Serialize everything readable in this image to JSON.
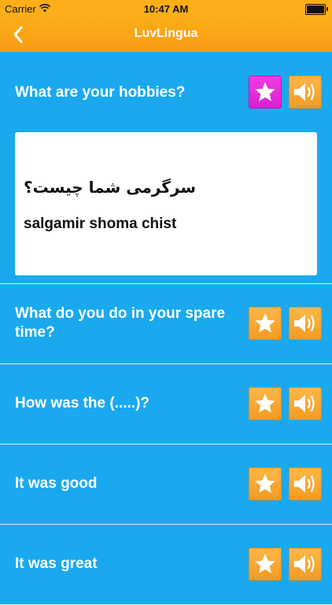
{
  "status_bar": {
    "carrier": "Carrier",
    "time": "10:47 AM",
    "wifi_icon": "wifi-icon",
    "battery_icon": "battery-icon"
  },
  "nav": {
    "title": "LuvLingua",
    "back_icon": "chevron-left-icon"
  },
  "colors": {
    "header_orange": "#fbae18",
    "list_background": "#1aa9ee",
    "favorite_active": "#e82bdc",
    "favorite_inactive": "#f7a52f"
  },
  "phrases": [
    {
      "text": "What are your hobbies?",
      "favorited": true,
      "expanded": true,
      "translation": "سرگرمی شما چیست؟",
      "transliteration": "salgamir shoma chist"
    },
    {
      "text": "What do you do in your spare time?",
      "favorited": false
    },
    {
      "text": "How was the (.....)?",
      "favorited": false
    },
    {
      "text": "It was good",
      "favorited": false
    },
    {
      "text": "It was great",
      "favorited": false
    }
  ]
}
